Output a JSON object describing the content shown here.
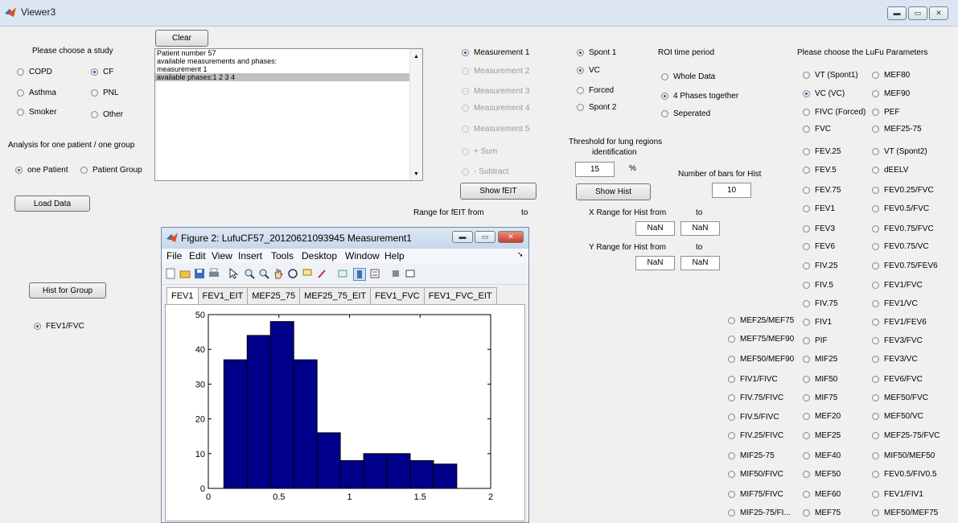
{
  "window": {
    "title": "Viewer3"
  },
  "left": {
    "study_label": "Please choose a study",
    "studies": [
      {
        "label": "COPD",
        "selected": false
      },
      {
        "label": "CF",
        "selected": true
      },
      {
        "label": "Asthma",
        "selected": false
      },
      {
        "label": "PNL",
        "selected": false
      },
      {
        "label": "Smoker",
        "selected": false
      },
      {
        "label": "Other",
        "selected": false
      }
    ],
    "analysis_label": "Analysis for one patient / one group",
    "one_patient": "one Patient",
    "patient_group": "Patient Group",
    "load_data": "Load Data",
    "hist_group": "Hist for Group",
    "group_param": "FEV1/FVC"
  },
  "clear_button": "Clear",
  "info_lines": [
    "Patient number 57",
    "available measurements and phases:",
    "measurement 1",
    "available phases:1  2  3  4"
  ],
  "measurements": [
    {
      "label": "Measurement 1",
      "selected": true,
      "enabled": true
    },
    {
      "label": "Measurement 2",
      "selected": false,
      "enabled": false
    },
    {
      "label": "Measurement 3",
      "selected": false,
      "enabled": false
    },
    {
      "label": "Measurement 4",
      "selected": false,
      "enabled": false
    },
    {
      "label": "Measurement 5",
      "selected": false,
      "enabled": false
    },
    {
      "label": "+ Sum",
      "selected": false,
      "enabled": false
    },
    {
      "label": "- Subtract",
      "selected": false,
      "enabled": false
    }
  ],
  "show_feit": "Show fEIT",
  "range_feit_label": "Range for fEIT from",
  "range_to": "to",
  "breathing": [
    {
      "label": "Spont 1",
      "selected": true
    },
    {
      "label": "VC",
      "selected": true
    },
    {
      "label": "Forced",
      "selected": false
    },
    {
      "label": "Spont 2",
      "selected": false
    }
  ],
  "roi": {
    "label": "ROI time period",
    "options": [
      {
        "label": "Whole Data",
        "selected": false
      },
      {
        "label": "4 Phases together",
        "selected": true
      },
      {
        "label": "Seperated",
        "selected": false
      }
    ]
  },
  "threshold": {
    "label1": "Threshold for lung regions",
    "label2": "identification",
    "value": "15",
    "unit": "%"
  },
  "bars": {
    "label": "Number of bars for Hist",
    "value": "10"
  },
  "show_hist": "Show Hist",
  "xrange": {
    "label": "X Range for Hist from",
    "to": "to",
    "from_val": "NaN",
    "to_val": "NaN"
  },
  "yrange": {
    "label": "Y Range for Hist from",
    "to": "to",
    "from_val": "NaN",
    "to_val": "NaN"
  },
  "lufu_label": "Please choose the LuFu Parameters",
  "lufu_col_mid": [
    "MEF25/MEF75",
    "MEF75/MEF90",
    "MEF50/MEF90",
    "FIV1/FIVC",
    "FIV.75/FIVC",
    "FIV.5/FIVC",
    "FIV.25/FIVC",
    "MIF25-75",
    "MIF50/FIVC",
    "MIF75/FIVC",
    "MIF25-75/FI..."
  ],
  "lufu_col_a": [
    "VT (Spont1)",
    "VC (VC)",
    "FIVC (Forced)",
    "FVC",
    "FEV.25",
    "FEV.5",
    "FEV.75",
    "FEV1",
    "FEV3",
    "FEV6",
    "FIV.25",
    "FIV.5",
    "FIV.75",
    "FIV1",
    "PIF",
    "MIF25",
    "MIF50",
    "MIF75",
    "MEF20",
    "MEF25",
    "MEF40",
    "MEF50",
    "MEF60",
    "MEF75"
  ],
  "lufu_col_b": [
    "MEF80",
    "MEF90",
    "PEF",
    "MEF25-75",
    "VT (Spont2)",
    "dEELV",
    "FEV0.25/FVC",
    "FEV0.5/FVC",
    "FEV0.75/FVC",
    "FEV0.75/VC",
    "FEV0.75/FEV6",
    "FEV1/FVC",
    "FEV1/VC",
    "FEV1/FEV6",
    "FEV3/FVC",
    "FEV3/VC",
    "FEV6/FVC",
    "MEF50/FVC",
    "MEF50/VC",
    "MEF25-75/FVC",
    "MIF50/MEF50",
    "FEV0.5/FIV0.5",
    "FEV1/FIV1",
    "MEF50/MEF75"
  ],
  "figure": {
    "title": "Figure 2: LufuCF57_20120621093945 Measurement1",
    "menus": [
      "File",
      "Edit",
      "View",
      "Insert",
      "Tools",
      "Desktop",
      "Window",
      "Help"
    ],
    "tabs": [
      "FEV1",
      "FEV1_EIT",
      "MEF25_75",
      "MEF25_75_EIT",
      "FEV1_FVC",
      "FEV1_FVC_EIT"
    ],
    "active_tab": 0
  },
  "chart_data": {
    "type": "bar",
    "title": "",
    "xlabel": "",
    "ylabel": "",
    "xlim": [
      0,
      2
    ],
    "ylim": [
      0,
      50
    ],
    "xticks": [
      0,
      0.5,
      1,
      1.5,
      2
    ],
    "xtick_labels": [
      "0",
      "0.5",
      "1",
      "1.5",
      "2"
    ],
    "yticks": [
      0,
      10,
      20,
      30,
      40,
      50
    ],
    "ytick_labels": [
      "0",
      "10",
      "20",
      "30",
      "40",
      "50"
    ],
    "bin_edges": [
      0.11,
      0.275,
      0.44,
      0.605,
      0.77,
      0.935,
      1.1,
      1.265,
      1.43,
      1.595,
      1.76
    ],
    "values": [
      37,
      44,
      48,
      37,
      16,
      8,
      10,
      10,
      8,
      7
    ],
    "bar_color": "#00008b"
  }
}
